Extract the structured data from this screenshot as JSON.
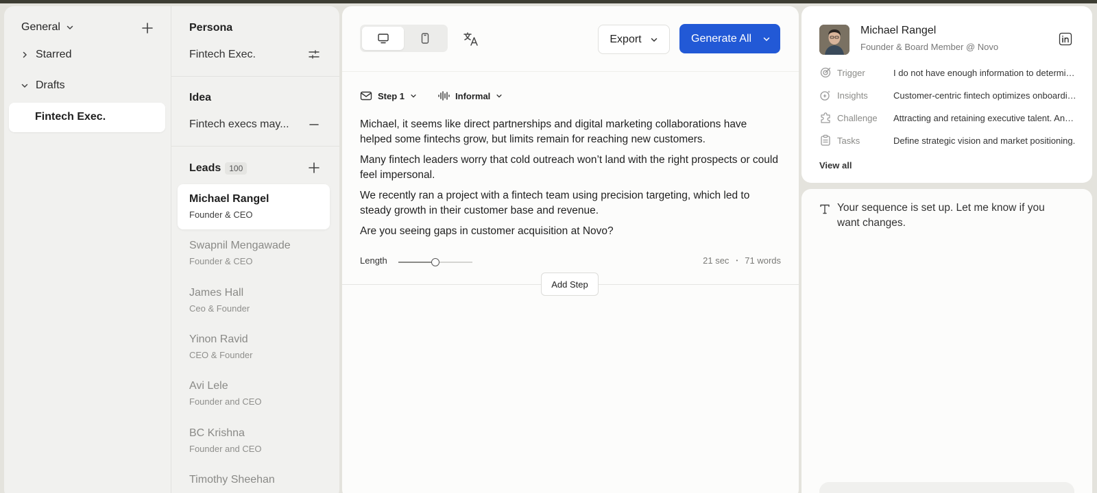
{
  "nav": {
    "section_label": "General",
    "items": [
      {
        "label": "Starred"
      },
      {
        "label": "Drafts"
      }
    ],
    "selected_draft": "Fintech Exec."
  },
  "persona": {
    "title": "Persona",
    "value": "Fintech Exec."
  },
  "idea": {
    "title": "Idea",
    "value": "Fintech execs may..."
  },
  "leads": {
    "title": "Leads",
    "count": "100",
    "items": [
      {
        "name": "Michael Rangel",
        "role": "Founder & CEO"
      },
      {
        "name": "Swapnil Mengawade",
        "role": "Founder & CEO"
      },
      {
        "name": "James Hall",
        "role": "Ceo & Founder"
      },
      {
        "name": "Yinon Ravid",
        "role": "CEO & Founder"
      },
      {
        "name": "Avi Lele",
        "role": "Founder and CEO"
      },
      {
        "name": "BC Krishna",
        "role": "Founder and CEO"
      },
      {
        "name": "Timothy Sheehan",
        "role": ""
      }
    ]
  },
  "toolbar": {
    "export_label": "Export",
    "generate_label": "Generate All",
    "accent_color": "#2259d6"
  },
  "step": {
    "step_label": "Step 1",
    "tone_label": "Informal",
    "paragraphs": [
      "Michael, it seems like direct partnerships and digital marketing collaborations have helped some fintechs grow, but limits remain for reaching new customers.",
      "Many fintech leaders worry that cold outreach won’t land with the right prospects or could feel impersonal.",
      "We recently ran a project with a fintech team using precision targeting, which led to steady growth in their customer base and revenue.",
      "Are you seeing gaps in customer acquisition at Novo?"
    ],
    "length_label": "Length",
    "length_level": 0.5,
    "duration": "21 sec",
    "word_count": "71 words",
    "add_step_label": "Add Step"
  },
  "profile": {
    "name": "Michael Rangel",
    "subtitle": "Founder & Board Member @ Novo",
    "rows": [
      {
        "icon": "trigger-icon",
        "label": "Trigger",
        "value": "I do not have enough information to determine a trigger."
      },
      {
        "icon": "insights-icon",
        "label": "Insights",
        "value": "Customer-centric fintech optimizes onboarding."
      },
      {
        "icon": "challenge-icon",
        "label": "Challenge",
        "value": "Attracting and retaining executive talent. And more."
      },
      {
        "icon": "tasks-icon",
        "label": "Tasks",
        "value": "Define strategic vision and market positioning."
      }
    ],
    "view_all_label": "View all"
  },
  "chat": {
    "message": "Your sequence is set up. Let me know if you want changes."
  }
}
